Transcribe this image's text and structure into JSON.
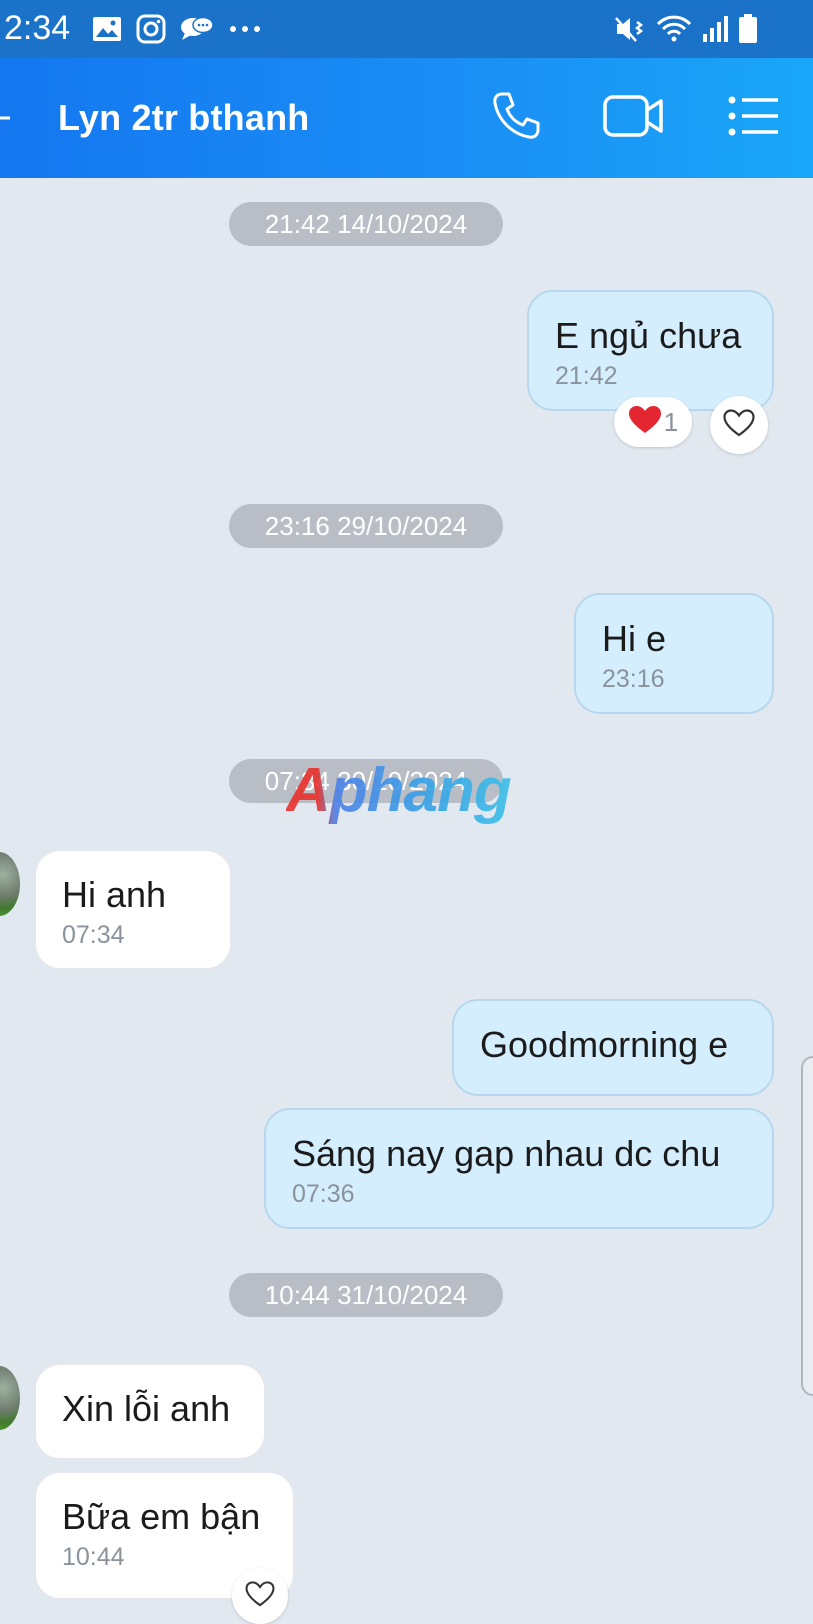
{
  "status_bar": {
    "time": "2:34",
    "left_icons": [
      "image-icon",
      "instagram-icon",
      "chat-bubbles-icon",
      "more-dots-icon"
    ],
    "right_icons": [
      "mute-vibrate-icon",
      "wifi-icon",
      "signal-icon",
      "battery-icon"
    ]
  },
  "header": {
    "title": "Lyn 2tr bthanh",
    "actions": [
      "phone-icon",
      "video-call-icon",
      "menu-icon"
    ],
    "accent_color": "#1a8cf5"
  },
  "messages": {
    "date_1": "21:42 14/10/2024",
    "m1": {
      "direction": "outgoing",
      "text": "E ngủ chưa",
      "time": "21:42"
    },
    "m1_reaction": {
      "emoji": "❤️",
      "count": "1"
    },
    "date_2": "23:16 29/10/2024",
    "m2": {
      "direction": "outgoing",
      "text": "Hi e",
      "time": "23:16"
    },
    "date_3": "07:34 30/10/2024",
    "m3": {
      "direction": "incoming",
      "text": "Hi anh",
      "time": "07:34"
    },
    "m4": {
      "direction": "outgoing",
      "text": "Goodmorning e"
    },
    "m5": {
      "direction": "outgoing",
      "text": "Sáng nay gap nhau dc chu",
      "time": "07:36"
    },
    "date_4": "10:44 31/10/2024",
    "m6": {
      "direction": "incoming",
      "text": "Xin lỗi anh"
    },
    "m7": {
      "direction": "incoming",
      "text": "Bữa em bận",
      "time": "10:44"
    }
  },
  "watermark": {
    "text": "Aphang"
  },
  "colors": {
    "chat_background": "#e2e8f0",
    "outgoing_bubble": "#d4eefe",
    "incoming_bubble": "#ffffff",
    "date_pill": "#b9bec6"
  }
}
